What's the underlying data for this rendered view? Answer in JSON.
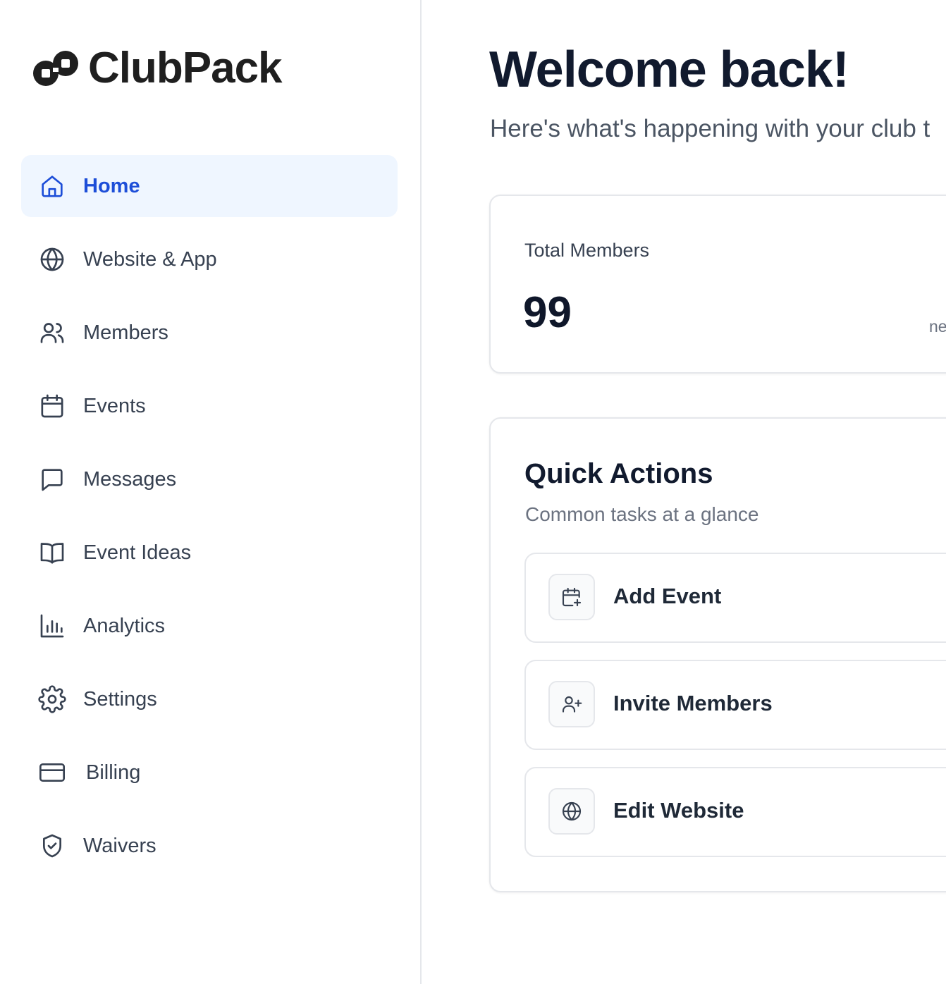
{
  "brand": {
    "name": "ClubPack",
    "logo_icon": "clubpack-logo-icon"
  },
  "sidebar": {
    "items": [
      {
        "label": "Home",
        "icon": "home-icon",
        "active": true
      },
      {
        "label": "Website & App",
        "icon": "globe-icon",
        "active": false
      },
      {
        "label": "Members",
        "icon": "users-icon",
        "active": false
      },
      {
        "label": "Events",
        "icon": "calendar-icon",
        "active": false
      },
      {
        "label": "Messages",
        "icon": "message-square-icon",
        "active": false
      },
      {
        "label": "Event Ideas",
        "icon": "book-open-icon",
        "active": false
      },
      {
        "label": "Analytics",
        "icon": "bar-chart-icon",
        "active": false
      },
      {
        "label": "Settings",
        "icon": "gear-icon",
        "active": false
      },
      {
        "label": "Billing",
        "icon": "credit-card-icon",
        "active": false
      },
      {
        "label": "Waivers",
        "icon": "shield-check-icon",
        "active": false
      }
    ]
  },
  "main": {
    "welcome": "Welcome back!",
    "subtitle": "Here's what's happening with your club t",
    "stat": {
      "label": "Total Members",
      "value": "99",
      "extra": "ne"
    },
    "quick_actions": {
      "title": "Quick Actions",
      "subtitle": "Common tasks at a glance",
      "items": [
        {
          "label": "Add Event",
          "icon": "calendar-plus-icon"
        },
        {
          "label": "Invite Members",
          "icon": "user-plus-icon"
        },
        {
          "label": "Edit Website",
          "icon": "globe-icon"
        }
      ]
    }
  },
  "colors": {
    "accent": "#1d4ed8",
    "active_bg": "#eff6ff",
    "text_dark": "#111a2e",
    "text_muted": "#6b7280",
    "border": "#e5e7eb"
  }
}
